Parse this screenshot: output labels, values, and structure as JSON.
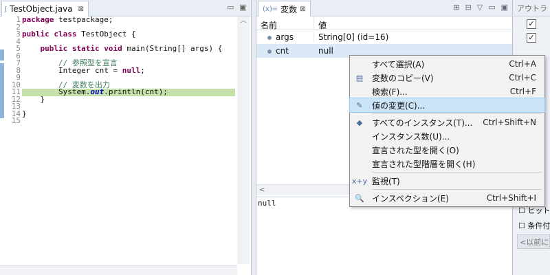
{
  "editor": {
    "tab_label": "TestObject.java",
    "tab_close": "⊠",
    "lines": [
      {
        "n": "1",
        "html": "<span class=\"kw\">package</span> testpackage;"
      },
      {
        "n": "2",
        "html": ""
      },
      {
        "n": "3",
        "html": "<span class=\"kw\">public class</span> TestObject {"
      },
      {
        "n": "4",
        "html": ""
      },
      {
        "n": "5",
        "html": "    <span class=\"kw\">public static void</span> main(String[] args) {"
      },
      {
        "n": "6",
        "html": ""
      },
      {
        "n": "7",
        "html": "        <span class=\"cm\">// 参照型を宣言</span>"
      },
      {
        "n": "8",
        "html": "        Integer cnt = <span class=\"kw\">null</span>;"
      },
      {
        "n": "9",
        "html": ""
      },
      {
        "n": "10",
        "html": "        <span class=\"cm\">// 変数を出力</span>"
      },
      {
        "n": "11",
        "html": "        System.<span class=\"ital\">out</span>.println(cnt);"
      },
      {
        "n": "12",
        "html": "    }"
      },
      {
        "n": "13",
        "html": ""
      },
      {
        "n": "14",
        "html": "}"
      },
      {
        "n": "15",
        "html": ""
      }
    ],
    "highlight_line": 11
  },
  "variables": {
    "tab_label": "変数",
    "col_name": "名前",
    "col_value": "値",
    "rows": [
      {
        "name": "args",
        "value": "String[0]  (id=16)"
      },
      {
        "name": "cnt",
        "value": "null"
      }
    ],
    "detail_text": "null"
  },
  "outline": {
    "tab_label": "アウトラ",
    "check1": "ヒット",
    "check2": "条件付",
    "button": "<以前に"
  },
  "context_menu": {
    "items": [
      {
        "label": "すべて選択(A)",
        "accel": "Ctrl+A",
        "icon": ""
      },
      {
        "label": "変数のコピー(V)",
        "accel": "Ctrl+C",
        "icon": "▤"
      },
      {
        "label": "検索(F)...",
        "accel": "Ctrl+F",
        "icon": ""
      },
      {
        "label": "値の変更(C)...",
        "accel": "",
        "icon": "✎"
      },
      {
        "sep": true
      },
      {
        "label": "すべてのインスタンス(T)...",
        "accel": "Ctrl+Shift+N",
        "icon": "◆"
      },
      {
        "label": "インスタンス数(U)...",
        "accel": "",
        "icon": ""
      },
      {
        "label": "宣言された型を開く(O)",
        "accel": "",
        "icon": ""
      },
      {
        "label": "宣言された型階層を開く(H)",
        "accel": "",
        "icon": ""
      },
      {
        "sep": true
      },
      {
        "label": "監視(T)",
        "accel": "",
        "icon": "x+y"
      },
      {
        "sep": true
      },
      {
        "label": "インスペクション(E)",
        "accel": "Ctrl+Shift+I",
        "icon": "🔍"
      }
    ],
    "active_index": 3
  }
}
